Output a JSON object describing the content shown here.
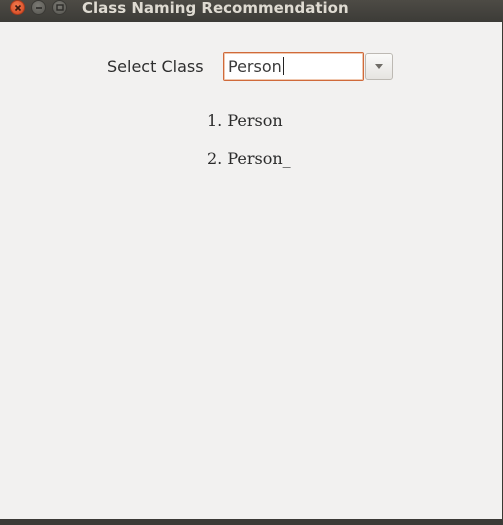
{
  "window": {
    "title": "Class Naming Recommendation"
  },
  "form": {
    "label": "Select Class",
    "combo_value": "Person"
  },
  "results": {
    "items": [
      {
        "number": "1.",
        "name": "Person"
      },
      {
        "number": "2.",
        "name": "Person_"
      }
    ]
  },
  "icons": {
    "close": "close-icon",
    "minimize": "minimize-icon",
    "maximize": "maximize-icon",
    "dropdown": "chevron-down-icon"
  },
  "colors": {
    "titlebar": "#3c3b37",
    "window_bg": "#f2f1f0",
    "focus_border": "#d06a3a",
    "close_button": "#d2441f"
  }
}
